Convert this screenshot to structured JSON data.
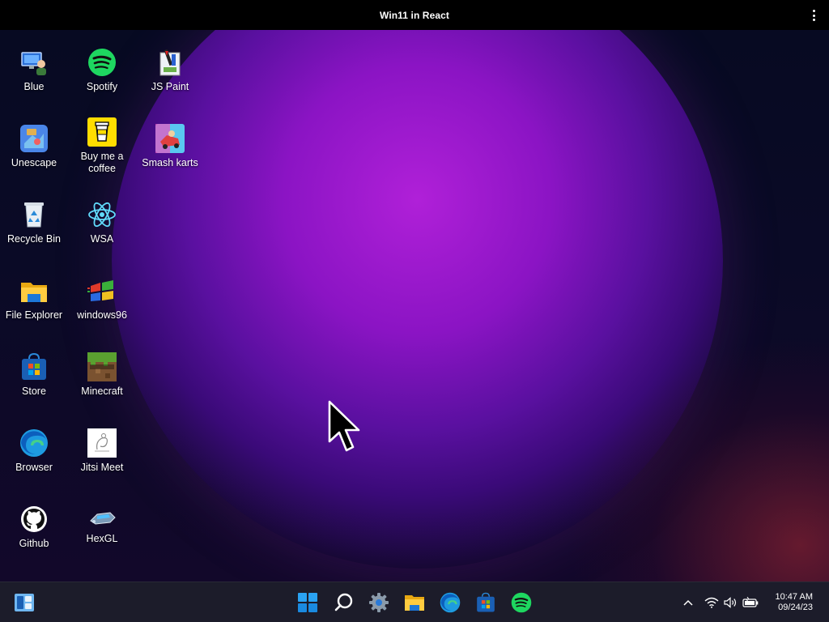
{
  "window": {
    "title": "Win11 in React"
  },
  "desktop_icons": [
    {
      "label": "Blue",
      "icon": "blue-computer-icon"
    },
    {
      "label": "Spotify",
      "icon": "spotify-icon"
    },
    {
      "label": "JS Paint",
      "icon": "js-paint-icon"
    },
    {
      "label": "Unescape",
      "icon": "unescape-icon"
    },
    {
      "label": "Buy me a coffee",
      "icon": "coffee-cup-icon"
    },
    {
      "label": "Smash karts",
      "icon": "smash-karts-icon"
    },
    {
      "label": "Recycle Bin",
      "icon": "recycle-bin-icon"
    },
    {
      "label": "WSA",
      "icon": "react-atom-icon"
    },
    {
      "label": "File Explorer",
      "icon": "folder-icon"
    },
    {
      "label": "windows96",
      "icon": "windows96-flag-icon"
    },
    {
      "label": "Store",
      "icon": "store-icon"
    },
    {
      "label": "Minecraft",
      "icon": "minecraft-icon"
    },
    {
      "label": "Browser",
      "icon": "edge-icon"
    },
    {
      "label": "Jitsi Meet",
      "icon": "jitsi-icon"
    },
    {
      "label": "Github",
      "icon": "github-icon"
    },
    {
      "label": "HexGL",
      "icon": "hexgl-icon"
    }
  ],
  "taskbar": {
    "left": [
      "widgets-icon"
    ],
    "center": [
      "start-windows-icon",
      "search-icon",
      "settings-gear-icon",
      "file-explorer-icon",
      "edge-icon",
      "store-icon",
      "spotify-icon"
    ],
    "tray": [
      "chevron-up-icon",
      "wifi-icon",
      "volume-icon",
      "battery-icon"
    ],
    "clock": {
      "time": "10:47 AM",
      "date": "09/24/23"
    }
  },
  "colors": {
    "taskbar_bg": "#1c1c2a",
    "accent_blue": "#0a78d7",
    "spotify_green": "#1ed760"
  }
}
